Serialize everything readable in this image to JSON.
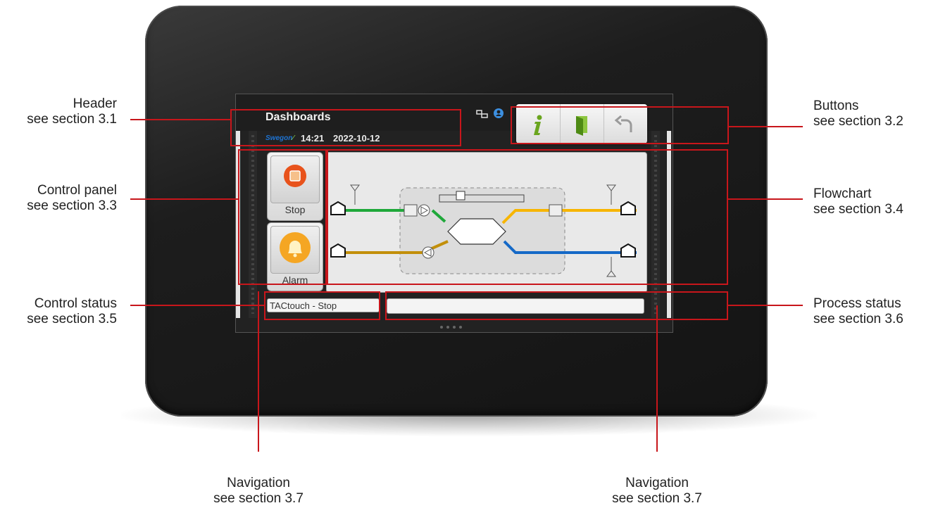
{
  "screen": {
    "title": "Dashboards",
    "brand": "Swegon",
    "time": "14:21",
    "date": "2022-10-12",
    "header_icons": [
      "network-icon",
      "user-icon"
    ],
    "buttons": [
      {
        "name": "info-button",
        "icon": "info-icon",
        "color": "#6aa51e"
      },
      {
        "name": "exit-button",
        "icon": "door-icon",
        "color": "#6aa51e"
      },
      {
        "name": "back-button",
        "icon": "return-arrow-icon",
        "color": "#9a9a9a"
      }
    ],
    "controls": [
      {
        "label": "Stop",
        "icon": "stop-icon",
        "color": "#e8521b"
      },
      {
        "label": "Alarm",
        "icon": "bell-icon",
        "color": "#f5a623"
      }
    ],
    "control_status": "TACtouch - Stop",
    "process_status": "",
    "flowchart": {
      "supply_in_color": "#1fa83a",
      "supply_out_color": "#f7b500",
      "extract_in_color": "#c28f0a",
      "extract_out_color": "#1569c7"
    }
  },
  "callouts": {
    "header": {
      "title": "Header",
      "ref": "see section 3.1"
    },
    "buttons": {
      "title": "Buttons",
      "ref": "see section 3.2"
    },
    "control_panel": {
      "title": "Control panel",
      "ref": "see section 3.3"
    },
    "flowchart": {
      "title": "Flowchart",
      "ref": "see section 3.4"
    },
    "control_status": {
      "title": "Control status",
      "ref": "see section 3.5"
    },
    "process_status": {
      "title": "Process status",
      "ref": "see section 3.6"
    },
    "navigation_left": {
      "title": "Navigation",
      "ref": "see section 3.7"
    },
    "navigation_right": {
      "title": "Navigation",
      "ref": "see section 3.7"
    }
  },
  "annotation_color": "#c8161b"
}
